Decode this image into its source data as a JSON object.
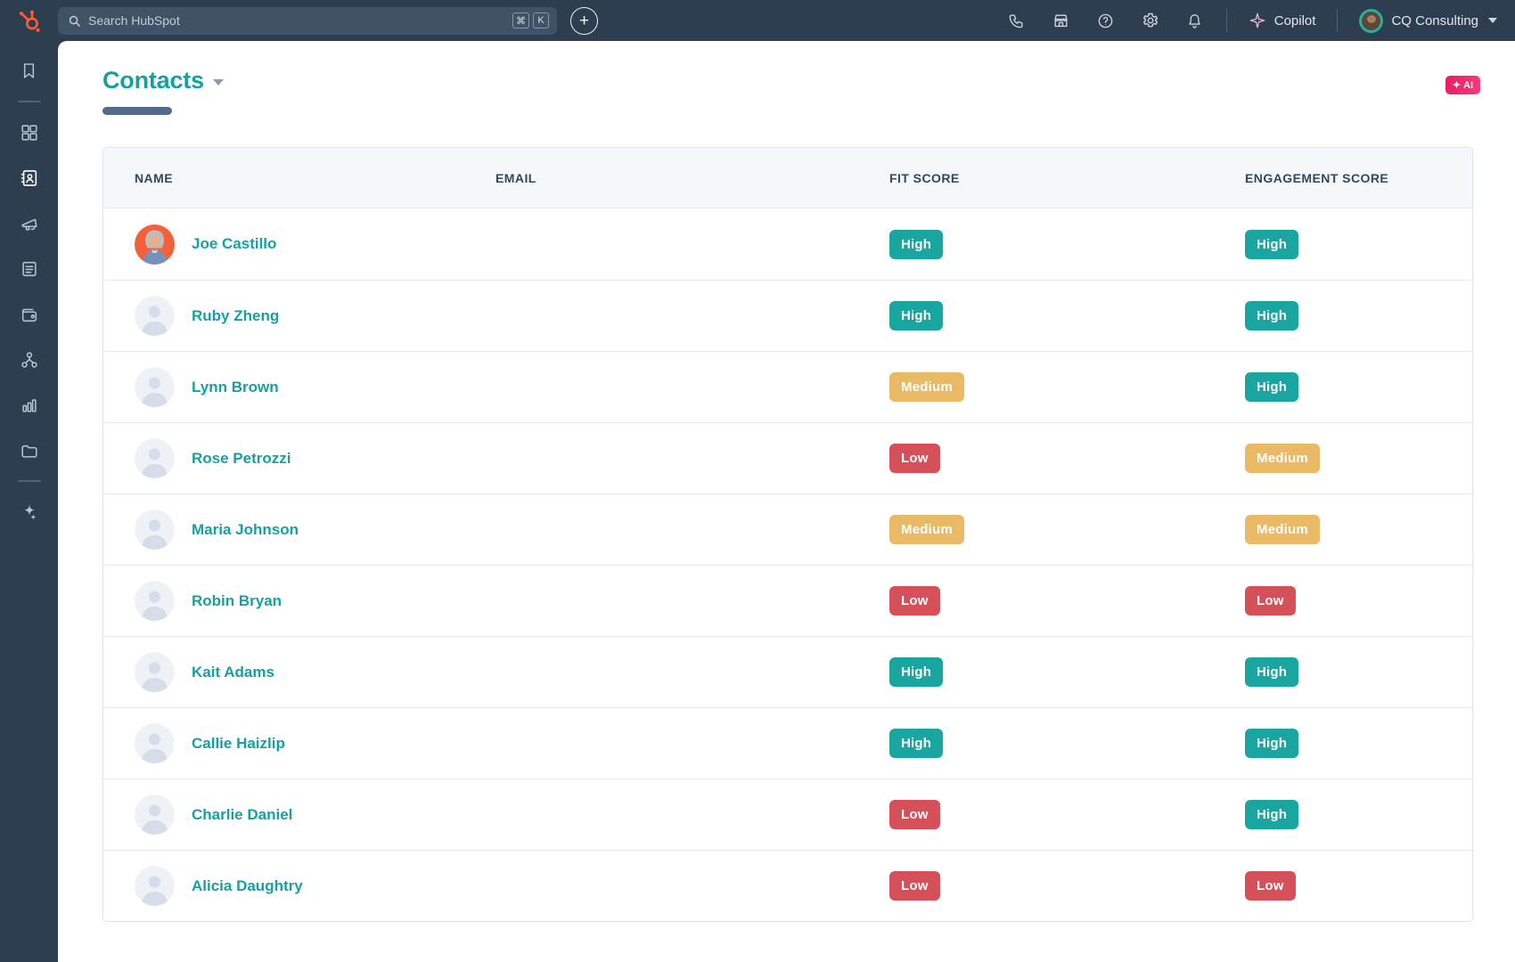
{
  "topbar": {
    "search": {
      "placeholder": "Search HubSpot",
      "shortcut_cmd": "⌘",
      "shortcut_key": "K"
    },
    "add_label": "+",
    "icons": [
      "phone",
      "marketplace",
      "help",
      "settings",
      "notifications"
    ],
    "copilot_label": "Copilot",
    "account_name": "CQ Consulting"
  },
  "sidebar": {
    "icons": [
      "bookmarks",
      "dashboards",
      "contacts",
      "marketing",
      "content",
      "commerce",
      "automations",
      "reporting",
      "data-management",
      "ai-assistant"
    ],
    "active": "contacts"
  },
  "page": {
    "title": "Contacts",
    "ai_badge_label": "AI",
    "ai_badge_sparkle": "✦"
  },
  "table": {
    "columns": [
      "NAME",
      "EMAIL",
      "FIT SCORE",
      "ENGAGEMENT SCORE"
    ],
    "rows": [
      {
        "name": "Joe Castillo",
        "fit_score": "High",
        "engagement_score": "High",
        "has_photo": true
      },
      {
        "name": "Ruby Zheng",
        "fit_score": "High",
        "engagement_score": "High",
        "has_photo": false
      },
      {
        "name": "Lynn Brown",
        "fit_score": "Medium",
        "engagement_score": "High",
        "has_photo": false
      },
      {
        "name": "Rose Petrozzi",
        "fit_score": "Low",
        "engagement_score": "Medium",
        "has_photo": false
      },
      {
        "name": "Maria Johnson",
        "fit_score": "Medium",
        "engagement_score": "Medium",
        "has_photo": false
      },
      {
        "name": "Robin Bryan",
        "fit_score": "Low",
        "engagement_score": "Low",
        "has_photo": false
      },
      {
        "name": "Kait Adams",
        "fit_score": "High",
        "engagement_score": "High",
        "has_photo": false
      },
      {
        "name": "Callie Haizlip",
        "fit_score": "High",
        "engagement_score": "High",
        "has_photo": false
      },
      {
        "name": "Charlie Daniel",
        "fit_score": "Low",
        "engagement_score": "High",
        "has_photo": false
      },
      {
        "name": "Alicia Daughtry",
        "fit_score": "Low",
        "engagement_score": "Low",
        "has_photo": false
      }
    ]
  },
  "colors": {
    "badge_high": "#19a5a0",
    "badge_medium": "#e9b965",
    "badge_low": "#d6505a",
    "accent_teal": "#16a0a0",
    "topbar_bg": "#2d3e50",
    "hubspot_orange": "#ff5c35",
    "ai_badge_pink": "#e81d61"
  }
}
